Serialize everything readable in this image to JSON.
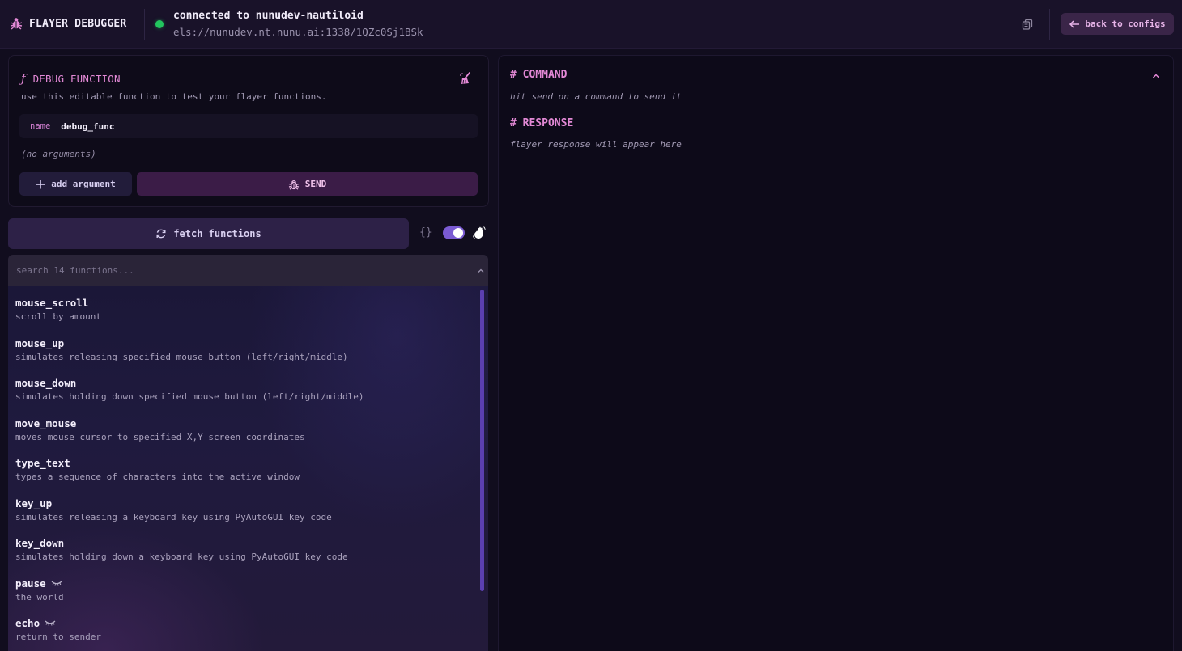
{
  "header": {
    "app_title": "FLAYER DEBUGGER",
    "logo_icon": "bug-icon",
    "connection_status": "connected to nunudev-nautiloid",
    "connection_url": "els://nunudev.nt.nunu.ai:1338/1QZc0Sj1BSk",
    "status_color": "#22c55e",
    "copy_icon": "copy-icon",
    "back_button": "back to configs"
  },
  "debug_function": {
    "title": "DEBUG FUNCTION",
    "title_glyph": "ƒ",
    "description": "use this editable function to test your flayer functions.",
    "name_label": "name",
    "name_value": "debug_func",
    "no_arguments": "(no arguments)",
    "add_argument": "add argument",
    "send": "SEND"
  },
  "controls": {
    "fetch_functions": "fetch functions",
    "json_toggle_label": "{}",
    "json_toggle_on": true
  },
  "functions": {
    "search_placeholder": "search 14 functions...",
    "items": [
      {
        "name": "mouse_scroll",
        "description": "scroll by amount"
      },
      {
        "name": "mouse_up",
        "description": "simulates releasing specified mouse button (left/right/middle)"
      },
      {
        "name": "mouse_down",
        "description": "simulates holding down specified mouse button (left/right/middle)"
      },
      {
        "name": "move_mouse",
        "description": "moves mouse cursor to specified X,Y screen coordinates"
      },
      {
        "name": "type_text",
        "description": "types a sequence of characters into the active window"
      },
      {
        "name": "key_up",
        "description": "simulates releasing a keyboard key using PyAutoGUI key code"
      },
      {
        "name": "key_down",
        "description": "simulates holding down a keyboard key using PyAutoGUI key code"
      },
      {
        "name": "pause",
        "description": "the world",
        "badge": "closed-eye-icon"
      },
      {
        "name": "echo",
        "description": "return to sender",
        "badge": "closed-eye-icon"
      }
    ]
  },
  "output": {
    "command_title": "# COMMAND",
    "command_hint": "hit send on a command to send it",
    "response_title": "# RESPONSE",
    "response_hint": "flayer response will appear here"
  },
  "colors": {
    "accent_pink": "#e389d6",
    "accent_purple": "#7b5bd3",
    "background": "#110d1e"
  }
}
